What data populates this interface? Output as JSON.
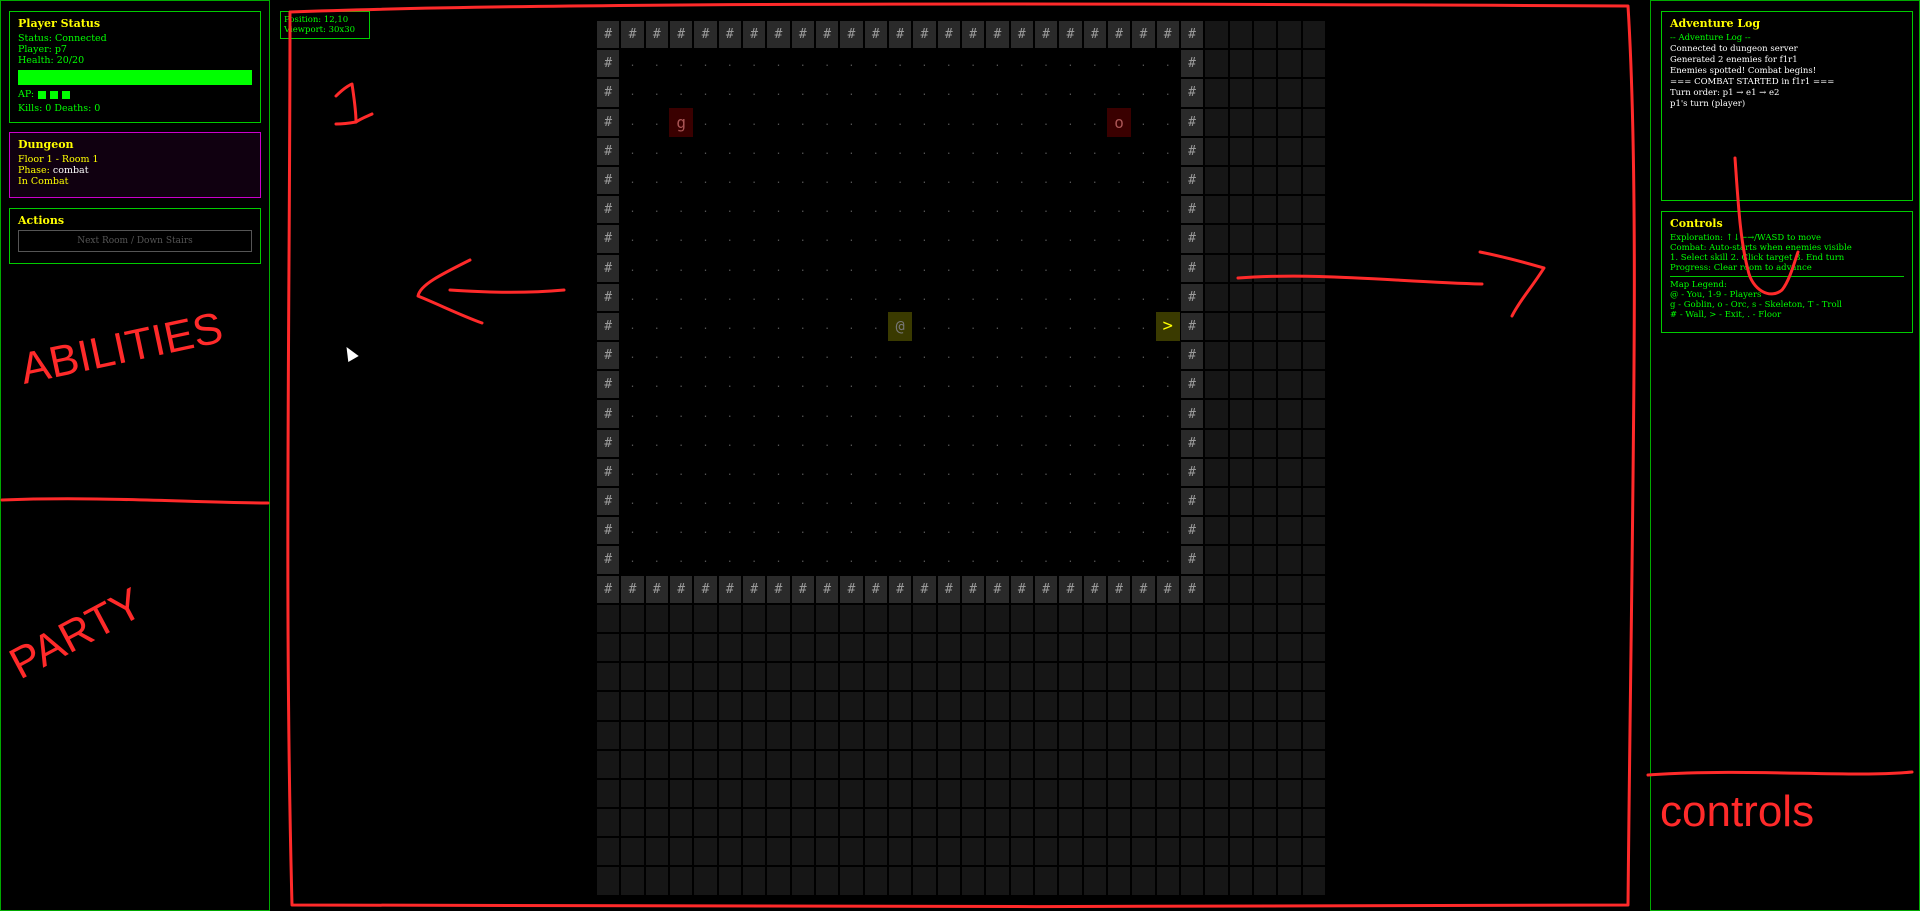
{
  "player_status": {
    "title": "Player Status",
    "status": "Status: Connected",
    "player": "Player: p7",
    "health": "Health: 20/20",
    "health_fraction": 1.0,
    "ap_label": "AP:",
    "ap_value": 3,
    "kills_deaths": "Kills: 0 Deaths: 0"
  },
  "dungeon": {
    "title": "Dungeon",
    "location": "Floor 1 - Room 1",
    "phase_label": "Phase: ",
    "phase_value": "combat",
    "combat_state": "In Combat"
  },
  "actions": {
    "title": "Actions",
    "next_room_button": "Next Room / Down Stairs"
  },
  "viewport_info": {
    "position": "Position: 12,10",
    "viewport": "Viewport: 30x30"
  },
  "adventure_log": {
    "title": "Adventure Log",
    "header": "-- Adventure Log --",
    "entries": [
      "Connected to dungeon server",
      "Generated 2 enemies for f1r1",
      "Enemies spotted! Combat begins!",
      "=== COMBAT STARTED in f1r1 ===",
      "Turn order: p1 → e1 → e2",
      "p1's turn (player)"
    ]
  },
  "controls": {
    "title": "Controls",
    "lines": [
      "Exploration: ↑↓←→/WASD to move",
      "Combat: Auto-starts when enemies visible",
      "1. Select skill 2. Click target 3. End turn",
      "Progress: Clear room to advance"
    ],
    "legend_title": "Map Legend:",
    "legend_lines": [
      "@ - You, 1-9 - Players",
      "g - Goblin, o - Orc, s - Skeleton, T - Troll",
      "# - Wall, > - Exit, . - Floor"
    ]
  },
  "map": {
    "wall_char": "#",
    "floor_char": ".",
    "enemy_goblin_char": "g",
    "enemy_orc_char": "o",
    "player_char": "@",
    "exit_char": ">",
    "rows": 30,
    "cols": 30,
    "room_rows": 20,
    "room_cols": 25
  },
  "annotations": {
    "abilities": "ABILITIES",
    "party": "PARTY",
    "one": "1",
    "controls": "controls"
  },
  "colors": {
    "accent_green": "#00ff00",
    "title_yellow": "#ffff00",
    "dungeon_border": "#cc00cc",
    "annotation_red": "#ff2a2a"
  }
}
